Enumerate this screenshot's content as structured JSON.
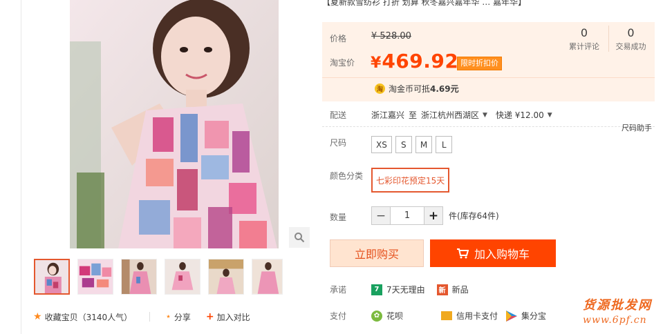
{
  "product": {
    "title_tail": "【夏新款雪纺衫 打折 划算 秋冬嘉兴嘉年华 …  嘉年华】"
  },
  "price": {
    "label": "价格",
    "original": "¥ 528.00",
    "promo_label": "淘宝价",
    "currency": "¥",
    "promo_amount": "469.92",
    "promo_tag": "限时折扣价",
    "coin_icon": "淘",
    "coin_text_prefix": "淘金币可抵",
    "coin_value": "4.69元"
  },
  "stats": {
    "reviews_count": "0",
    "reviews_label": "累计评论",
    "sales_count": "0",
    "sales_label": "交易成功"
  },
  "shipping": {
    "label": "配送",
    "from": "浙江嘉兴",
    "to_word": "至",
    "to": "浙江杭州西湖区",
    "method": "快递 ¥12.00",
    "size_help": "尺码助手"
  },
  "options": {
    "size_label": "尺码",
    "sizes": [
      "XS",
      "S",
      "M",
      "L"
    ],
    "color_label": "颜色分类",
    "color_selected": "七彩印花预定15天",
    "qty_label": "数量",
    "qty_minus": "−",
    "qty_value": "1",
    "qty_plus": "+",
    "stock": "件(库存64件)"
  },
  "buttons": {
    "buy_now": "立即购买",
    "add_cart": "加入购物车"
  },
  "promise": {
    "label": "承诺",
    "items": [
      {
        "icon": "7",
        "text": "7天无理由",
        "color": "#19a15f"
      },
      {
        "icon": "新",
        "text": "新品",
        "color": "#e4572e"
      }
    ]
  },
  "payment": {
    "label": "支付",
    "items": [
      {
        "text": "花呗"
      },
      {
        "text": "信用卡支付"
      },
      {
        "text": "集分宝"
      }
    ]
  },
  "actions": {
    "favorite": "收藏宝贝（3140人气）",
    "share": "分享",
    "compare": "加入对比"
  },
  "watermark": {
    "line1": "货源批发网",
    "line2": "www.6pf.cn"
  },
  "colors": {
    "accent": "#ff4400",
    "accent_light": "#fff2e8"
  }
}
